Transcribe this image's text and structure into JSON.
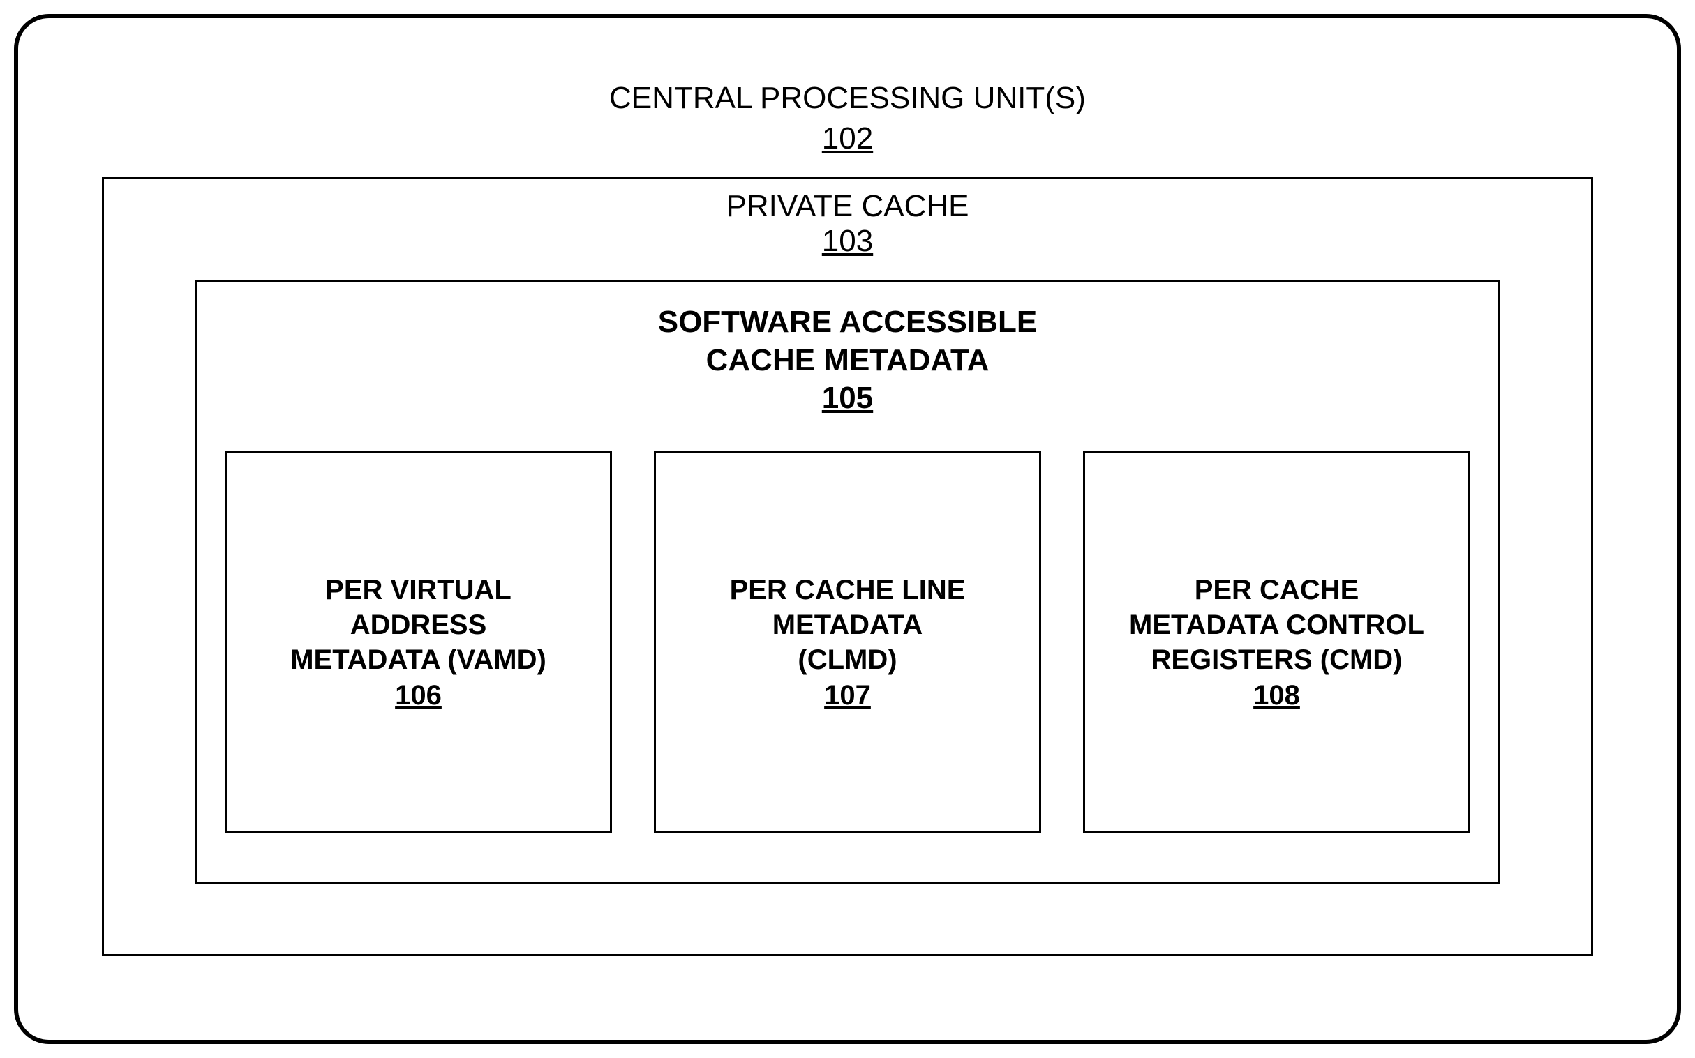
{
  "cpu": {
    "title": "CENTRAL PROCESSING UNIT(S)",
    "ref": "102"
  },
  "privateCache": {
    "title": "PRIVATE CACHE",
    "ref": "103"
  },
  "metadata": {
    "title_line1": "SOFTWARE ACCESSIBLE",
    "title_line2": "CACHE METADATA",
    "ref": "105"
  },
  "boxes": [
    {
      "line1": "PER VIRTUAL",
      "line2": "ADDRESS",
      "line3": "METADATA (VAMD)",
      "ref": "106"
    },
    {
      "line1": "PER CACHE LINE",
      "line2": "METADATA",
      "line3": "(CLMD)",
      "ref": "107"
    },
    {
      "line1": "PER CACHE",
      "line2": "METADATA CONTROL",
      "line3": "REGISTERS (CMD)",
      "ref": "108"
    }
  ]
}
